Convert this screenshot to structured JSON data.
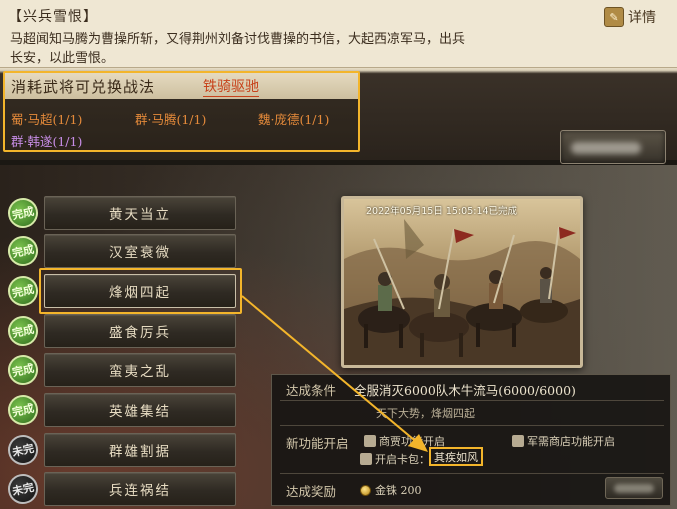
{
  "event": {
    "title": "【兴兵雪恨】",
    "description_line1": "马超闻知马腾为曹操所斩，又得荆州刘备讨伐曹操的书信，大起西凉军马，出兵",
    "description_line2": "长安，以此雪恨。",
    "detail_label": "详情"
  },
  "exchange": {
    "title": "消耗武将可兑换战法",
    "tactic": "铁骑驱驰",
    "requirements": [
      {
        "text": "蜀·马超(1/1)",
        "color": "#e48a3a"
      },
      {
        "text": "群·马腾(1/1)",
        "color": "#e48a3a"
      },
      {
        "text": "魏·庞德(1/1)",
        "color": "#e48a3a"
      },
      {
        "text": "群·韩遂(1/1)",
        "color": "#c78de6"
      }
    ]
  },
  "chapters": [
    {
      "label": "黄天当立",
      "badge": "完成",
      "status": "done"
    },
    {
      "label": "汉室衰微",
      "badge": "完成",
      "status": "done"
    },
    {
      "label": "烽烟四起",
      "badge": "完成",
      "status": "done"
    },
    {
      "label": "盛食厉兵",
      "badge": "完成",
      "status": "done"
    },
    {
      "label": "蛮夷之乱",
      "badge": "完成",
      "status": "done"
    },
    {
      "label": "英雄集结",
      "badge": "完成",
      "status": "done"
    },
    {
      "label": "群雄割据",
      "badge": "未完",
      "status": "pending"
    },
    {
      "label": "兵连祸结",
      "badge": "未完",
      "status": "pending"
    }
  ],
  "painting": {
    "stamp": "2022年05月15日 15:05:14已完成"
  },
  "info": {
    "condition_label": "达成条件",
    "condition_text": "全服消灭6000队木牛流马(6000/6000)",
    "condition_sub": "天下大势，烽烟四起",
    "function_label": "新功能开启",
    "functions": [
      "商贾功能开启",
      "军需商店功能开启",
      "开启卡包："
    ],
    "tactic_tag": "其疾如风",
    "reward_label": "达成奖励",
    "reward": "金铢 200"
  },
  "colors": {
    "highlight": "#f3b52b",
    "accent_red": "#c7421b",
    "badge_green": "#4f9a2f"
  }
}
